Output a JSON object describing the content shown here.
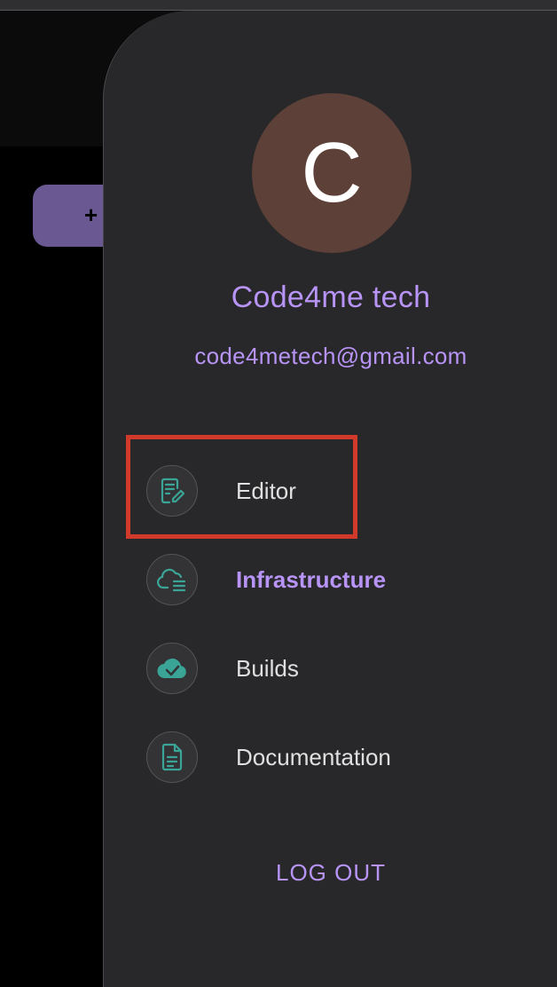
{
  "background": {
    "new_button_label": "+"
  },
  "user": {
    "initial": "C",
    "name": "Code4me tech",
    "email": "code4metech@gmail.com",
    "avatar_color": "#5d4037"
  },
  "nav": {
    "items": [
      {
        "label": "Editor",
        "icon": "editor-icon",
        "active": false
      },
      {
        "label": "Infrastructure",
        "icon": "cloud-list-icon",
        "active": true
      },
      {
        "label": "Builds",
        "icon": "cloud-check-icon",
        "active": false
      },
      {
        "label": "Documentation",
        "icon": "document-icon",
        "active": false
      }
    ]
  },
  "logout_label": "LOG OUT",
  "colors": {
    "accent": "#b794f6",
    "icon": "#3aa597",
    "drawer_bg": "#28282a",
    "highlight": "#d13a2a"
  }
}
